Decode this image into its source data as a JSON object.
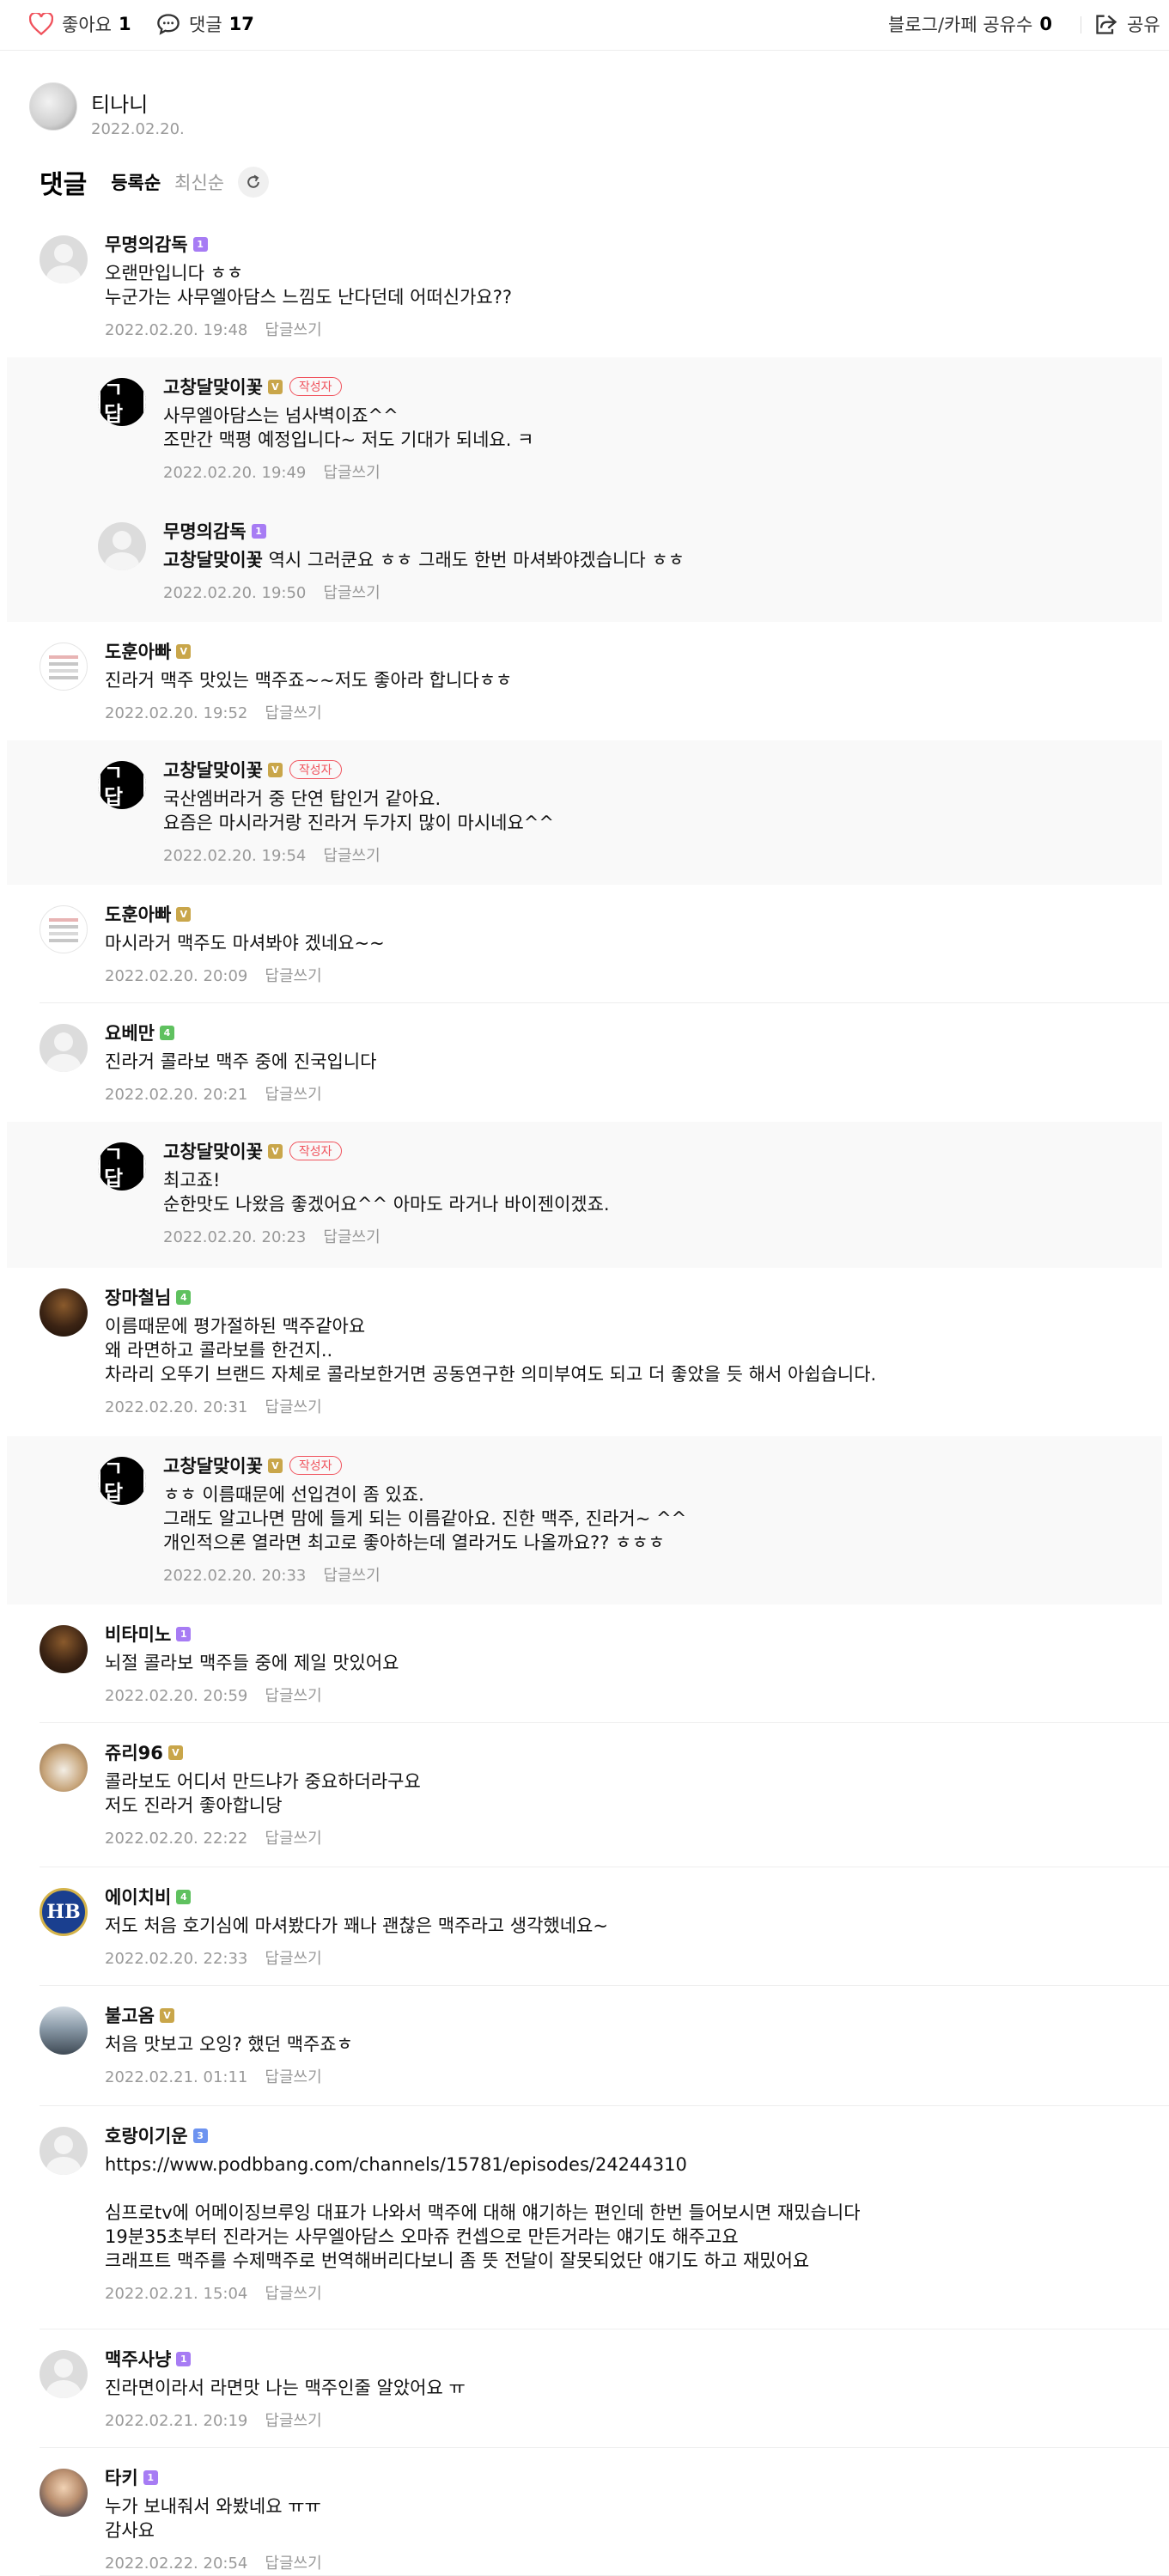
{
  "topbar": {
    "like_label": "좋아요",
    "like_count": "1",
    "comment_label": "댓글",
    "comment_count": "17",
    "share_count_label": "블로그/카페 공유수",
    "share_count": "0",
    "share_label": "공유"
  },
  "author": {
    "name": "티나니",
    "date": "2022.02.20."
  },
  "comments_header": {
    "title": "댓글",
    "sort_registered": "등록순",
    "sort_latest": "최신순"
  },
  "reply_label": "답글쓰기",
  "writer_badge": "작성자",
  "colors": {
    "accent_red": "#f0525c",
    "level_purple": "#a77cf4",
    "level_gold": "#c9a64a",
    "level_green": "#5fc15f",
    "reply_bg": "#f9f9f9"
  },
  "comments": [
    {
      "nick": "무명의감독",
      "level": "purple",
      "lines": [
        "오랜만입니다 ㅎㅎ",
        "누군가는 사무엘아담스 느낌도 난다던데 어떠신가요??"
      ],
      "date": "2022.02.20. 19:48",
      "avatar": "blank"
    },
    {
      "nick": "고창달맞이꽃",
      "level": "gold",
      "writer": true,
      "lines": [
        "사무엘아담스는 넘사벽이죠^^",
        "조만간 맥평 예정입니다~ 저도 기대가 되네요. ㅋ"
      ],
      "date": "2022.02.20. 19:49",
      "avatar": "brand"
    },
    {
      "nick": "무명의감독",
      "level": "purple",
      "mention": "고창달맞이꽃",
      "lines": [
        " 역시 그러쿤요 ㅎㅎ 그래도 한번 마셔봐야겠습니다 ㅎㅎ"
      ],
      "date": "2022.02.20. 19:50",
      "avatar": "blank"
    },
    {
      "nick": "도훈아빠",
      "level": "gold",
      "lines": [
        "진라거 맥주 맛있는 맥주죠~~저도 좋아라 합니다ㅎㅎ"
      ],
      "date": "2022.02.20. 19:52",
      "avatar": "doc"
    },
    {
      "nick": "고창달맞이꽃",
      "level": "gold",
      "writer": true,
      "lines": [
        "국산엠버라거 중 단연 탑인거 같아요.",
        "요즘은 마시라거랑 진라거 두가지 많이 마시네요^^"
      ],
      "date": "2022.02.20. 19:54",
      "avatar": "brand"
    },
    {
      "nick": "도훈아빠",
      "level": "gold",
      "lines": [
        "마시라거 맥주도 마셔봐야 겠네요~~"
      ],
      "date": "2022.02.20. 20:09",
      "avatar": "doc"
    },
    {
      "nick": "요베만",
      "level": "green",
      "lines": [
        "진라거 콜라보 맥주 중에 진국입니다"
      ],
      "date": "2022.02.20. 20:21",
      "avatar": "blank"
    },
    {
      "nick": "고창달맞이꽃",
      "level": "gold",
      "writer": true,
      "lines": [
        "최고죠!",
        "순한맛도 나왔음 좋겠어요^^ 아마도 라거나 바이젠이겠죠."
      ],
      "date": "2022.02.20. 20:23",
      "avatar": "brand"
    },
    {
      "nick": "장마철님",
      "level": "green",
      "lines": [
        "이름때문에 평가절하된 맥주같아요",
        "왜 라면하고 콜라보를 한건지..",
        "차라리 오뚜기 브랜드 자체로 콜라보한거면 공동연구한 의미부여도 되고 더 좋았을 듯 해서 아쉽습니다."
      ],
      "date": "2022.02.20. 20:31",
      "avatar": "beer"
    },
    {
      "nick": "고창달맞이꽃",
      "level": "gold",
      "writer": true,
      "lines": [
        "ㅎㅎ 이름때문에 선입견이 좀 있죠.",
        "그래도 알고나면 맘에 들게 되는 이름같아요. 진한 맥주, 진라거~ ^^",
        "개인적으론 열라면 최고로 좋아하는데 열라거도 나올까요?? ㅎㅎㅎ"
      ],
      "date": "2022.02.20. 20:33",
      "avatar": "brand"
    },
    {
      "nick": "비타미노",
      "level": "purple",
      "lines": [
        "뇌절 콜라보 맥주들 중에 제일 맛있어요"
      ],
      "date": "2022.02.20. 20:59",
      "avatar": "beer"
    },
    {
      "nick": "쥬리96",
      "level": "gold",
      "lines": [
        "콜라보도 어디서 만드냐가 중요하더라구요",
        "저도 진라거 좋아합니당"
      ],
      "date": "2022.02.20. 22:22",
      "avatar": "dog"
    },
    {
      "nick": "에이치비",
      "level": "green",
      "lines": [
        "저도 처음 호기심에 마셔봤다가 꽤나 괜찮은 맥주라고 생각했네요~"
      ],
      "date": "2022.02.20. 22:33",
      "avatar": "hb"
    },
    {
      "nick": "불고옴",
      "level": "gold",
      "lines": [
        "처음 맛보고 오잉? 했던 맥주죠ㅎ"
      ],
      "date": "2022.02.21. 01:11",
      "avatar": "group"
    },
    {
      "nick": "호랑이기운",
      "level": "blue",
      "lines": [
        "https://www.podbbang.com/channels/15781/episodes/24244310",
        "",
        "심프로tv에 어메이징브루잉 대표가 나와서 맥주에 대해 얘기하는 편인데 한번 들어보시면 재밌습니다",
        "19분35초부터 진라거는 사무엘아담스 오마쥬 컨셉으로 만든거라는 얘기도 해주고요",
        "크래프트 맥주를 수제맥주로 번역해버리다보니 좀 뜻 전달이 잘못되었단 얘기도 하고 재밌어요"
      ],
      "date": "2022.02.21. 15:04",
      "avatar": "blank"
    },
    {
      "nick": "맥주사냥",
      "level": "purple",
      "lines": [
        "진라면이라서 라면맛 나는 맥주인줄 알았어요 ㅠ"
      ],
      "date": "2022.02.21. 20:19",
      "avatar": "blank"
    },
    {
      "nick": "타키",
      "level": "purple",
      "lines": [
        "누가 보내줘서 와봤네요 ㅠㅠ",
        "감사요"
      ],
      "date": "2022.02.22. 20:54",
      "avatar": "tiki"
    }
  ]
}
